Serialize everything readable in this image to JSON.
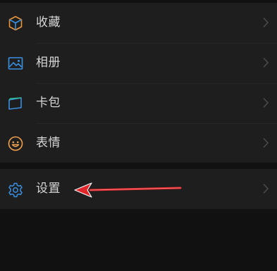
{
  "menu": {
    "items": [
      {
        "label": "收藏",
        "icon": "favorites-cube-icon",
        "color": "#e8943a"
      },
      {
        "label": "相册",
        "icon": "album-picture-icon",
        "color": "#3a8fe0"
      },
      {
        "label": "卡包",
        "icon": "card-wallet-icon",
        "color": "#3a8fe0"
      },
      {
        "label": "表情",
        "icon": "smiley-face-icon",
        "color": "#f0a050"
      }
    ],
    "settings": {
      "label": "设置",
      "icon": "gear-icon",
      "color": "#3a8fe0"
    }
  },
  "annotation": {
    "arrow_color": "#e0262b",
    "points_to": "设置"
  }
}
